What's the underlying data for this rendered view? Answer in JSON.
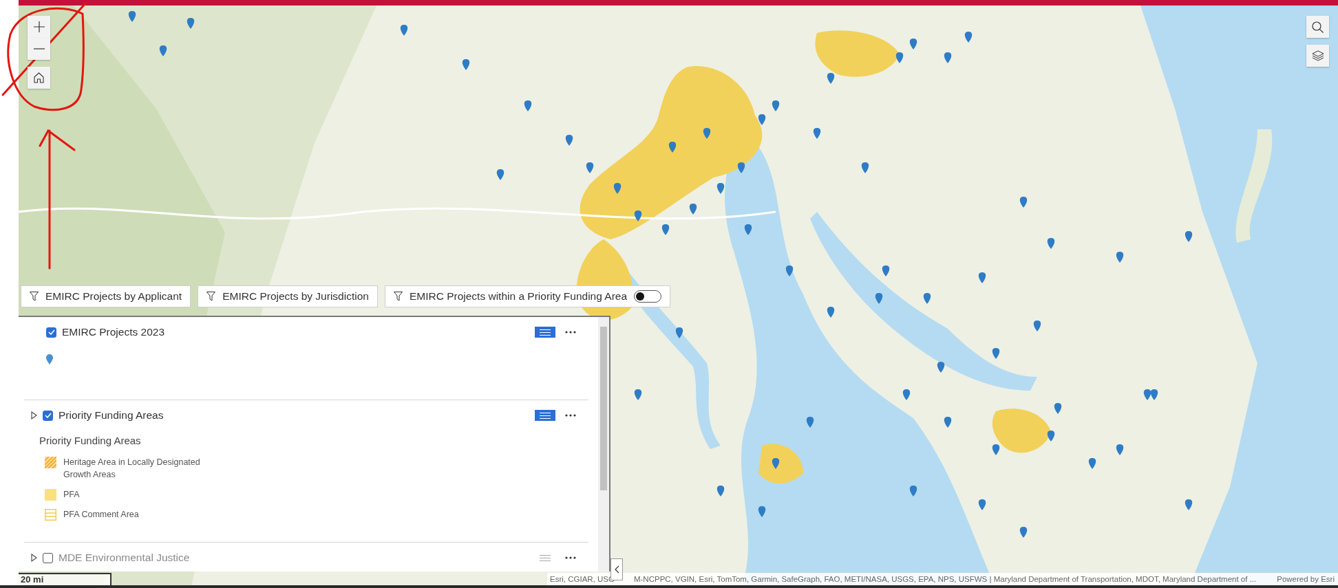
{
  "map": {
    "kind": "picture"
  },
  "filters": [
    {
      "label": "EMIRC Projects by Applicant",
      "kind": "filter"
    },
    {
      "label": "EMIRC Projects by Jurisdiction",
      "kind": "filter"
    },
    {
      "label": "EMIRC Projects within a Priority Funding Area",
      "kind": "toggle",
      "on": false
    }
  ],
  "layers": [
    {
      "title": "EMIRC Projects 2023",
      "checked": true,
      "expandable": false,
      "legend_open": true,
      "legend": {
        "kind": "pin"
      }
    },
    {
      "title": "Priority Funding Areas",
      "checked": true,
      "expandable": true,
      "legend_open": true,
      "legend": {
        "kind": "list",
        "title": "Priority Funding Areas",
        "items": [
          {
            "label": "Heritage Area in Locally Designated Growth Areas",
            "kind": "hatched"
          },
          {
            "label": "PFA",
            "kind": "solid"
          },
          {
            "label": "PFA Comment Area",
            "kind": "lined"
          }
        ]
      }
    },
    {
      "title": "MDE Environmental Justice",
      "checked": false,
      "expandable": true,
      "legend_open": false
    }
  ],
  "scale": "20 mi",
  "attribution": [
    "Esri, CGIAR, USG",
    "M-NCPPC, VGIN, Esri, TomTom, Garmin, SafeGraph, FAO, METI/NASA, USGS, EPA, NPS, USFWS | Maryland Department of Transportation, MDOT, Maryland Department of ..."
  ],
  "powered_by": "Powered by Esri"
}
